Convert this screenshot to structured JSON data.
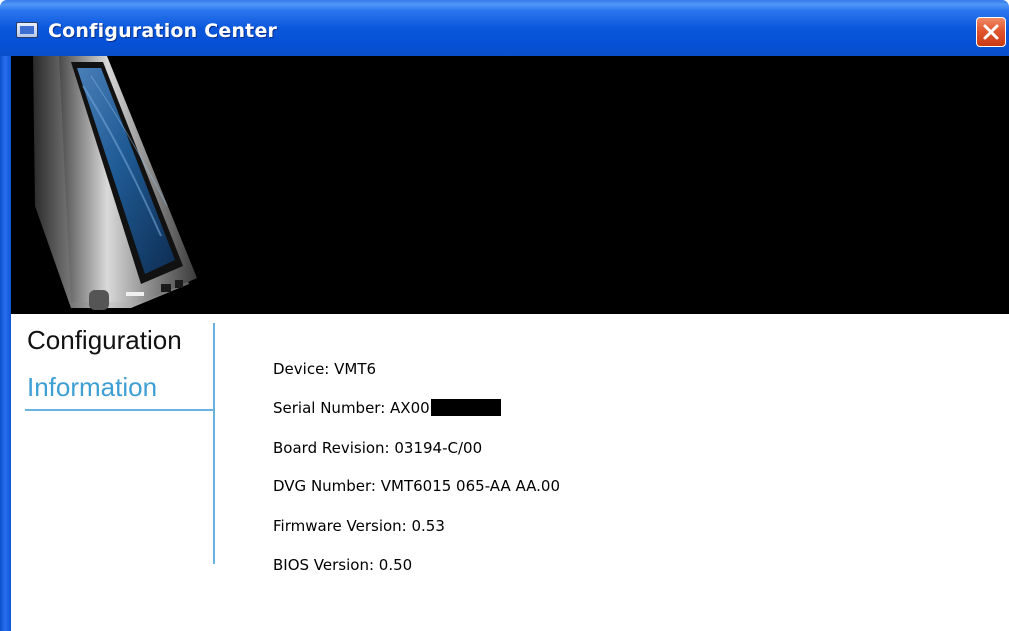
{
  "window": {
    "title": "Configuration Center",
    "icon": "app-window-icon",
    "close_icon": "close-icon",
    "colors": {
      "titlebar": "#0a5fe6",
      "close_button": "#e2562f",
      "banner": "#000000",
      "nav_active": "#3e9fd4"
    }
  },
  "banner": {
    "image": "tablet-device-image"
  },
  "nav": {
    "heading": "Configuration",
    "items": [
      {
        "label": "Information",
        "selected": true
      }
    ]
  },
  "info": {
    "device": "Device: VMT6",
    "serial": "Serial Number: AX00",
    "serial_redacted": true,
    "board_revision": "Board Revision: 03194-C/00",
    "dvg_number": "DVG Number: VMT6015 065-AA AA.00",
    "firmware_version": "Firmware Version: 0.53",
    "bios_version": "BIOS Version: 0.50"
  }
}
